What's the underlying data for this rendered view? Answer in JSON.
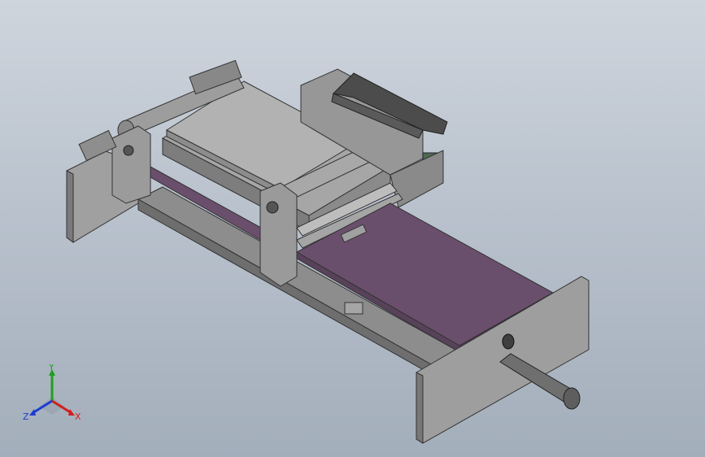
{
  "viewport": {
    "background_top": "#cfd5dd",
    "background_bottom": "#a3aebb"
  },
  "model": {
    "part_color": "#9a9a9a",
    "part_dark": "#6f6f6f",
    "plate_color": "#6a4f6c",
    "bracket_color": "#4c4c4c"
  },
  "triad": {
    "x_label": "X",
    "y_label": "Y",
    "z_label": "Z",
    "x_color": "#d21e1e",
    "y_color": "#1ea01e",
    "z_color": "#1e3cd2"
  }
}
